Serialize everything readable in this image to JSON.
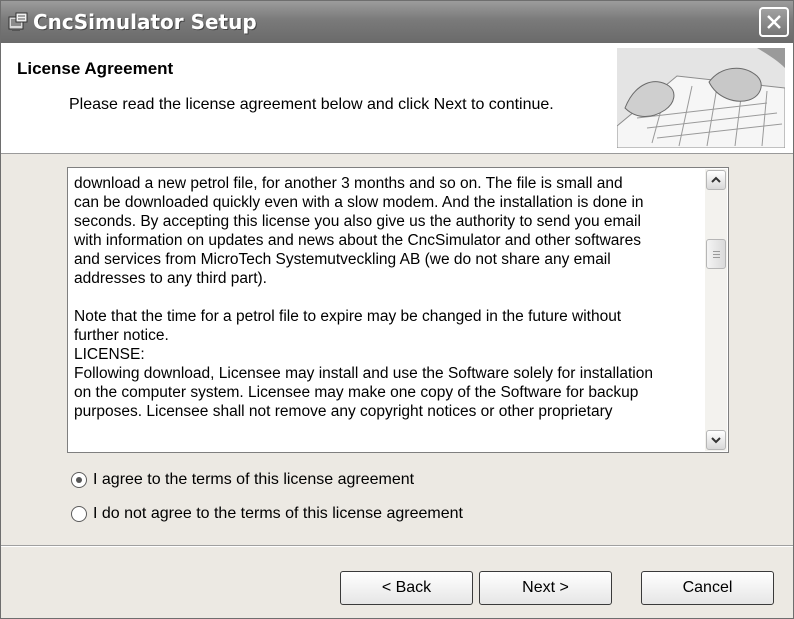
{
  "window": {
    "title": "CncSimulator Setup",
    "title_icon": "setup-installer-icon",
    "close_icon": "close-icon"
  },
  "header": {
    "title": "License Agreement",
    "subtitle": "Please read the license agreement below and click Next to continue.",
    "image": "keyboard-hands-photo"
  },
  "license": {
    "lines": [
      "download a new petrol file, for another 3 months and so on. The file is small and",
      "can be downloaded quickly even with a slow modem. And the installation is done in",
      "seconds. By accepting this license you also give us the authority to send you email",
      "with information on updates and news about the CncSimulator and other softwares",
      "and services from MicroTech Systemutveckling AB (we do not share any email",
      "addresses to any third part).",
      "",
      "Note that the time for a petrol file to expire may be changed in the future without",
      "further notice.",
      "LICENSE:",
      "Following download, Licensee may install and use the Software solely for installation",
      "on the computer system. Licensee may make one copy of the Software for backup",
      "purposes. Licensee shall not remove any copyright notices or other proprietary"
    ],
    "scroll_up_icon": "scroll-up-arrow-icon",
    "scroll_down_icon": "scroll-down-arrow-icon"
  },
  "options": {
    "agree_label": "I agree to the terms of this license agreement",
    "disagree_label": "I do not agree to the terms of this license agreement",
    "selected": "agree"
  },
  "buttons": {
    "back": "< Back",
    "next": "Next >",
    "cancel": "Cancel"
  }
}
